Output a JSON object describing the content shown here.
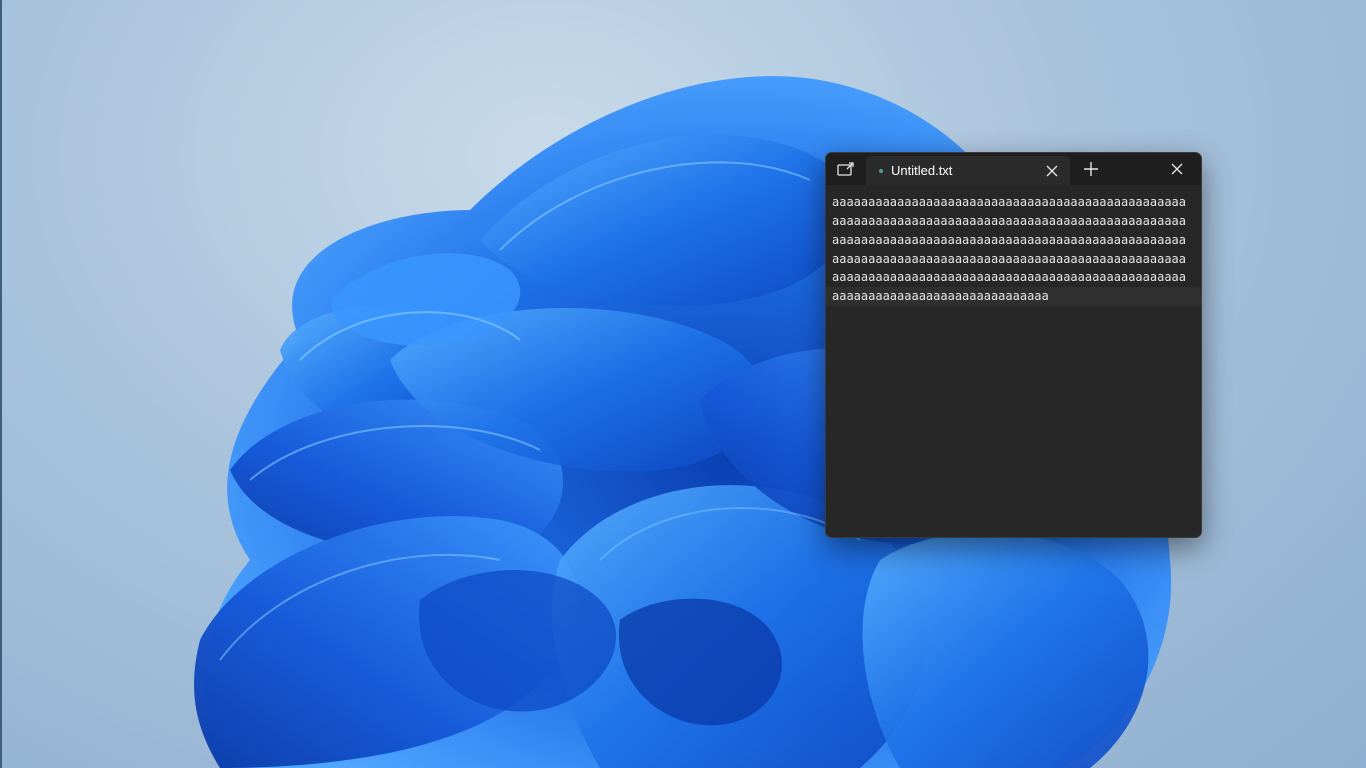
{
  "desktop": {
    "wallpaper": "Windows 11 bloom wallpaper",
    "colors": {
      "background": "#a9c3dc",
      "bloom": "#1f6fe8",
      "bloom_light": "#4fa6ff",
      "bloom_dark": "#0a3fb0"
    }
  },
  "notepad": {
    "compact_icon": "compact-overlay-icon",
    "tab": {
      "title": "Untitled.txt",
      "unsaved_indicator_icon": "dot-icon",
      "close_icon": "close-icon"
    },
    "new_tab_icon": "plus-icon",
    "window_close_icon": "close-icon",
    "editor": {
      "lines": [
        "aaaaaaaaaaaaaaaaaaaaaaaaaaaaaaaaaaaaaaaaaaaaaaaaa",
        "aaaaaaaaaaaaaaaaaaaaaaaaaaaaaaaaaaaaaaaaaaaaaaaaa",
        "aaaaaaaaaaaaaaaaaaaaaaaaaaaaaaaaaaaaaaaaaaaaaaaaa",
        "aaaaaaaaaaaaaaaaaaaaaaaaaaaaaaaaaaaaaaaaaaaaaaaaa",
        "aaaaaaaaaaaaaaaaaaaaaaaaaaaaaaaaaaaaaaaaaaaaaaaaa",
        "aaaaaaaaaaaaaaaaaaaaaaaaaaaaaa"
      ]
    },
    "colors": {
      "background": "#272727",
      "titlebar": "#1f1f1f",
      "text": "#e6e6e6"
    }
  }
}
